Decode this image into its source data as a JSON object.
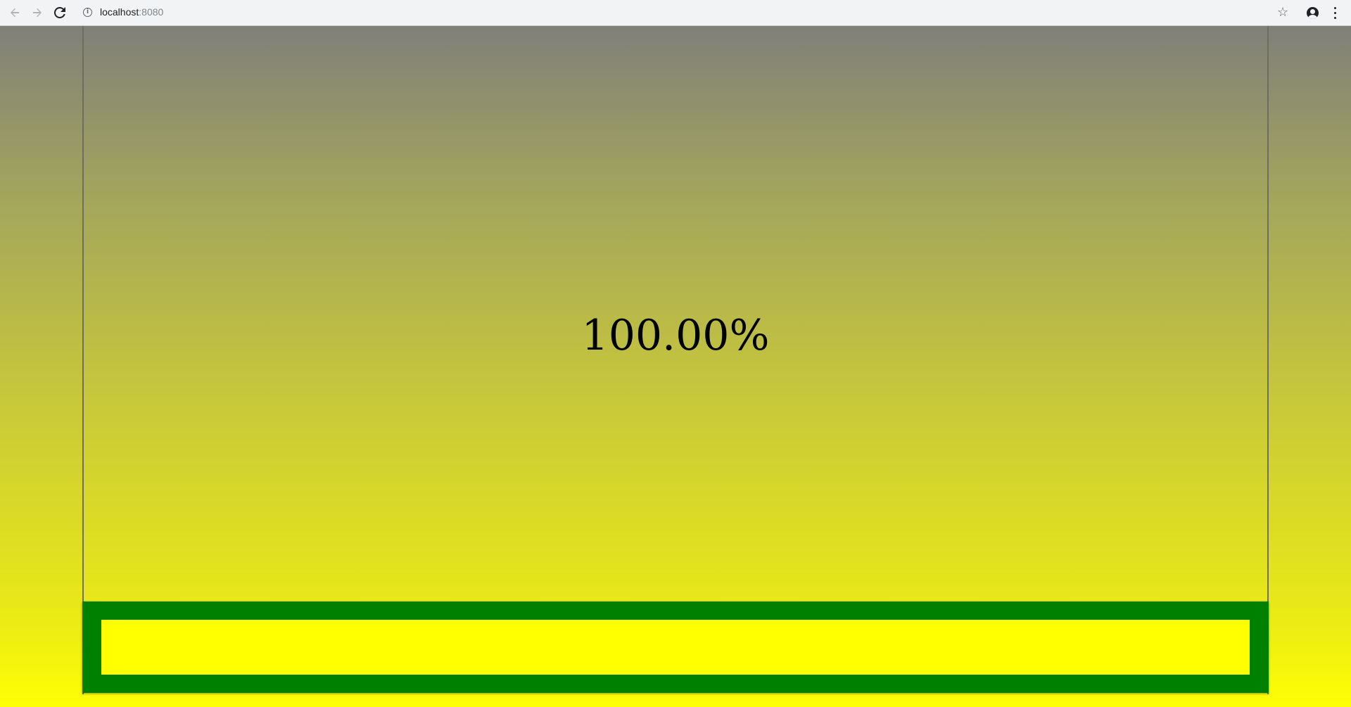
{
  "browser": {
    "url_host": "localhost",
    "url_port": ":8080"
  },
  "progress": {
    "label": "100.00%",
    "fraction": 1.0,
    "track_color": "#008000",
    "fill_color": "#ffff00"
  },
  "icons": {
    "back": "arrow-left",
    "forward": "arrow-right",
    "reload": "reload",
    "info": "info",
    "bookmark": "star",
    "profile": "account-circle",
    "menu": "vertical-dots"
  }
}
